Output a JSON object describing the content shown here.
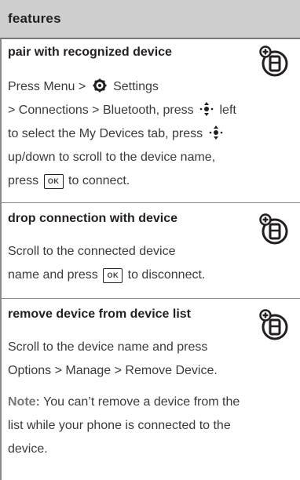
{
  "header": {
    "title": "features"
  },
  "sections": [
    {
      "title": "pair with recognized device",
      "line1_a": "Press Menu >",
      "line1_b": "Settings",
      "line2_a": "> Connections > Bluetooth, press",
      "line2_b": "left",
      "line3_a": "to select the My Devices tab, press",
      "line4": "up/down to scroll to the device name,",
      "line5_a": "press",
      "line5_b": "to connect."
    },
    {
      "title": "drop connection with device",
      "line1": "Scroll to the connected device",
      "line2_a": "name and press",
      "line2_b": "to disconnect."
    },
    {
      "title": "remove device from device list",
      "line1": "Scroll to the device name and press",
      "line2": "Options > Manage > Remove Device.",
      "note_label": "Note:",
      "note_line1": "You can’t remove a device from the",
      "note_line2": "list while your phone is connected to the",
      "note_line3": "device."
    }
  ],
  "keys": {
    "ok": "OK"
  },
  "icons": [
    "phone-feature-icon",
    "settings-gear-icon",
    "nav-key-icon",
    "ok-key-icon"
  ]
}
